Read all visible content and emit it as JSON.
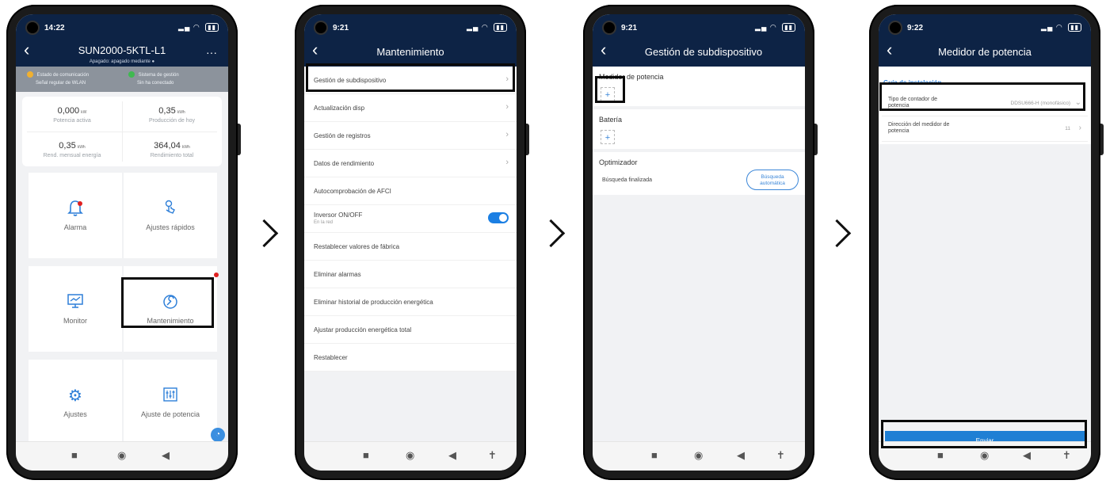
{
  "phones": [
    {
      "status_time": "14:22",
      "title": "SUN2000-5KTL-L1",
      "subtitle": "Apagado: apagado mediante ●",
      "info_left": [
        "Estado de comunicación",
        "Señal regular de WLAN"
      ],
      "info_right": [
        "Sistema de gestión",
        "Sin ha conectado"
      ],
      "stats": [
        {
          "value": "0,000",
          "unit": "kW",
          "label": "Potencia activa"
        },
        {
          "value": "0,35",
          "unit": "kWh",
          "label": "Producción de hoy"
        },
        {
          "value": "0,35",
          "unit": "kWh",
          "label": "Rend. mensual energía"
        },
        {
          "value": "364,04",
          "unit": "kWh",
          "label": "Rendimiento total"
        }
      ],
      "tiles": [
        {
          "label": "Alarma",
          "icon": "bell-icon"
        },
        {
          "label": "Ajustes rápidos",
          "icon": "hand-touch-icon"
        },
        {
          "label": "Monitor",
          "icon": "monitor-icon"
        },
        {
          "label": "Mantenimiento",
          "icon": "wrench-icon"
        },
        {
          "label": "Ajustes",
          "icon": "gear-icon"
        },
        {
          "label": "Ajuste de potencia",
          "icon": "sliders-icon"
        }
      ]
    },
    {
      "status_time": "9:21",
      "title": "Mantenimiento",
      "menu": [
        {
          "label": "Gestión de subdispositivo"
        },
        {
          "label": "Actualización disp"
        },
        {
          "label": "Gestión de registros"
        },
        {
          "label": "Datos de rendimiento"
        },
        {
          "label": "Autocomprobación de AFCI"
        },
        {
          "label": "Inversor ON/OFF",
          "sub": "En la red"
        },
        {
          "label": "Restablecer valores de fábrica"
        },
        {
          "label": "Eliminar alarmas"
        },
        {
          "label": "Eliminar historial de producción energética"
        },
        {
          "label": "Ajustar producción energética total"
        },
        {
          "label": "Restablecer"
        }
      ]
    },
    {
      "status_time": "9:21",
      "title": "Gestión de subdispositivo",
      "sections": {
        "meter": "Medidor de potencia",
        "battery": "Batería",
        "optimizer": "Optimizador",
        "search_status": "Búsqueda finalizada",
        "search_button": [
          "Búsqueda",
          "automática"
        ]
      }
    },
    {
      "status_time": "9:22",
      "title": "Medidor de potencia",
      "guide": "Guía de instalación",
      "fields": [
        {
          "label": [
            "Tipo de contador de",
            "potencia"
          ],
          "value": "DDSU666-H (monofásico)"
        },
        {
          "label": [
            "Dirección del medidor de",
            "potencia"
          ],
          "value": "11"
        }
      ],
      "submit": "Enviar"
    }
  ]
}
